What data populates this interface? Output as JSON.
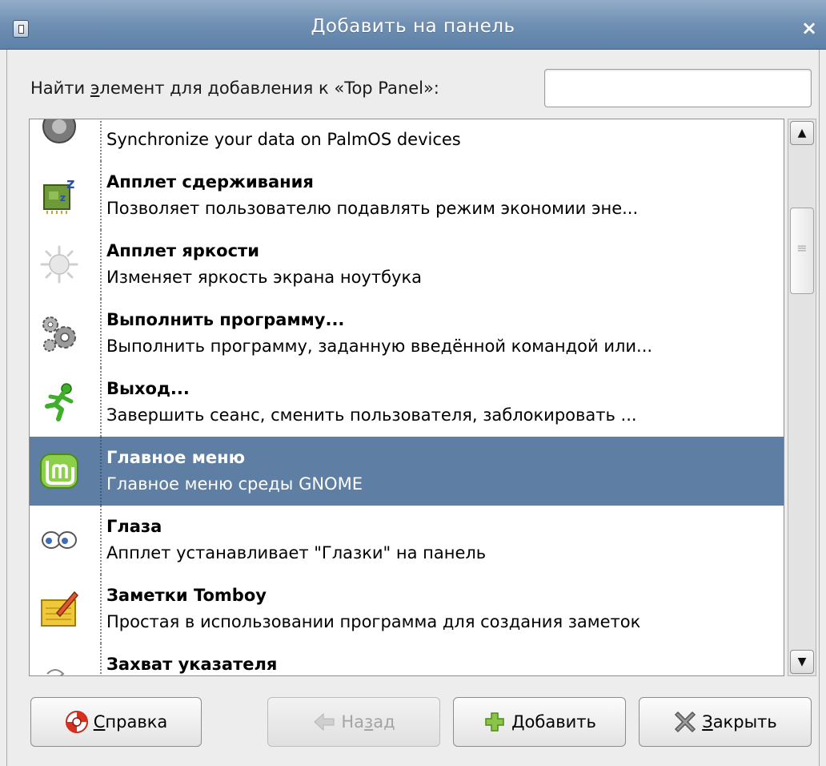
{
  "window": {
    "title": "Добавить на панель",
    "close_glyph": "×"
  },
  "search": {
    "label_before": "Найти ",
    "label_mnemonic": "э",
    "label_after": "лемент для добавления к «Top Panel»:",
    "value": "",
    "placeholder": ""
  },
  "list": {
    "items": [
      {
        "name": "",
        "desc": "Synchronize your data on PalmOS devices",
        "icon": "palm-sync-icon"
      },
      {
        "name": "Апплет сдерживания",
        "desc": "Позволяет пользователю подавлять режим экономии эне...",
        "icon": "inhibit-applet-icon"
      },
      {
        "name": "Апплет яркости",
        "desc": "Изменяет яркость экрана ноутбука",
        "icon": "brightness-icon"
      },
      {
        "name": "Выполнить программу...",
        "desc": "Выполнить программу, заданную введённой командой или...",
        "icon": "gears-icon"
      },
      {
        "name": "Выход...",
        "desc": "Завершить сеанс, сменить пользователя, заблокировать ...",
        "icon": "running-man-icon"
      },
      {
        "name": "Главное меню",
        "desc": "Главное меню среды GNOME",
        "icon": "mint-menu-icon",
        "selected": true
      },
      {
        "name": "Глаза",
        "desc": "Апплет устанавливает \"Глазки\" на панель",
        "icon": "eyes-icon"
      },
      {
        "name": "Заметки Tomboy",
        "desc": "Простая в использовании программа для создания заметок",
        "icon": "tomboy-notes-icon"
      },
      {
        "name": "Захват указателя",
        "desc": "",
        "icon": "pointer-capture-icon"
      }
    ]
  },
  "scrollbar": {
    "up_glyph": "▲",
    "down_glyph": "▼"
  },
  "buttons": {
    "help": {
      "mnemonic": "С",
      "rest": "правка",
      "icon": "lifebuoy-icon"
    },
    "back": {
      "before": "На",
      "mnemonic": "з",
      "after": "ад",
      "icon": "back-arrow-icon",
      "disabled": true
    },
    "add": {
      "mnemonic": "Д",
      "rest": "обавить",
      "icon": "plus-icon"
    },
    "close": {
      "mnemonic": "З",
      "rest": "акрыть",
      "icon": "close-x-icon"
    }
  }
}
